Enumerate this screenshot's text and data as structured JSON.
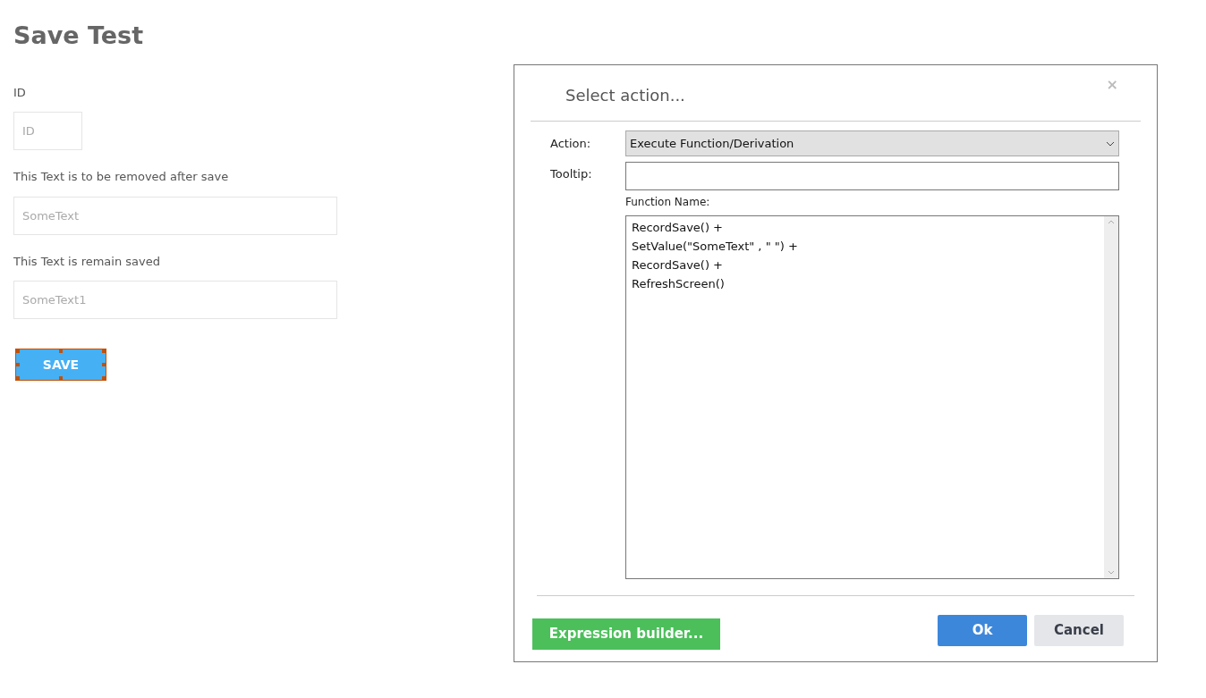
{
  "page": {
    "title": "Save Test"
  },
  "form_fields": [
    {
      "label": "ID",
      "placeholder": "ID"
    },
    {
      "label": "This Text is to be removed after save",
      "placeholder": "SomeText"
    },
    {
      "label": "This Text is remain saved",
      "placeholder": "SomeText1"
    }
  ],
  "save_button": {
    "label": "SAVE",
    "selected": true
  },
  "dialog": {
    "title": "Select action...",
    "close": "×",
    "action": {
      "label": "Action:",
      "value": "Execute Function/Derivation"
    },
    "tooltip": {
      "label": "Tooltip:"
    },
    "function_name": {
      "label": "Function Name:",
      "lines": [
        "RecordSave() +",
        "SetValue(\"SomeText\" , \" \") +",
        "RecordSave() +",
        "RefreshScreen()"
      ]
    },
    "buttons": [
      {
        "label": "Expression builder...",
        "kind": "builder"
      },
      {
        "label": "Ok",
        "kind": "primary"
      },
      {
        "label": "Cancel",
        "kind": "secondary"
      }
    ]
  }
}
